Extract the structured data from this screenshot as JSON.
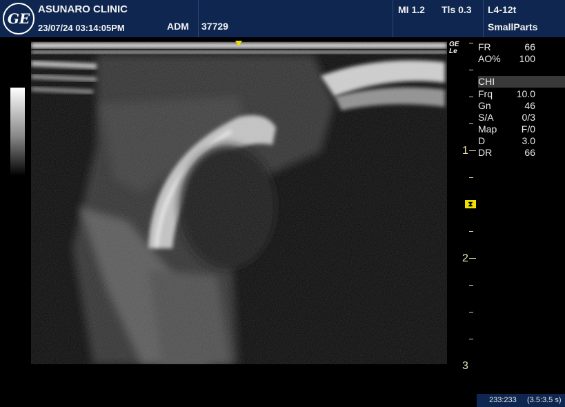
{
  "header": {
    "logo_text": "GE",
    "clinic": "ASUNARO CLINIC",
    "datetime": "23/07/24 03:14:05PM",
    "mode": "ADM",
    "patient_id": "37729",
    "mi": "MI 1.2",
    "tis": "Tls 0.3",
    "probe": "L4-12t",
    "preset": "SmallParts"
  },
  "image_mark": {
    "line1": "GE",
    "line2": "Le"
  },
  "params_top": [
    {
      "key": "FR",
      "value": "66"
    },
    {
      "key": "AO%",
      "value": "100"
    }
  ],
  "chi_label": "CHI",
  "params_bottom": [
    {
      "key": "Frq",
      "value": "10.0"
    },
    {
      "key": "Gn",
      "value": "46"
    },
    {
      "key": "S/A",
      "value": "0/3"
    },
    {
      "key": "Map",
      "value": "F/0"
    },
    {
      "key": "D",
      "value": "3.0"
    },
    {
      "key": "DR",
      "value": "66"
    }
  ],
  "depth_labels": [
    "1",
    "2",
    "3"
  ],
  "status": {
    "coords": "233:233",
    "time": "(3.5:3.5 s)"
  }
}
